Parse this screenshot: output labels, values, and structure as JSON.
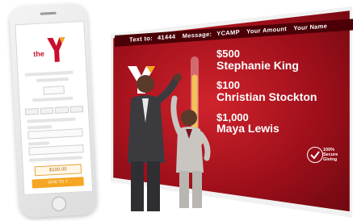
{
  "phone": {
    "logo_text": "the",
    "amount_value": "$100.00",
    "give_button_label": "GIVE TO Y"
  },
  "screen": {
    "topbar": {
      "text_to_label": "Text to:",
      "text_to_number": "41444",
      "message_label": "Message:",
      "message_value": "YCAMP",
      "amount_placeholder": "Your Amount",
      "name_placeholder": "Your Name"
    },
    "donors": [
      {
        "amount": "$500",
        "name": "Stephanie King"
      },
      {
        "amount": "$100",
        "name": "Christian Stockton"
      },
      {
        "amount": "$1,000",
        "name": "Maya Lewis"
      }
    ],
    "badge": {
      "line1": "100%",
      "line2": "Secure",
      "line3": "Giving"
    },
    "thermometer_fill_fraction": 0.78
  },
  "colors": {
    "ymca_red": "#c8102e",
    "ymca_orange": "#f5a623",
    "screen_red": "#b3141f",
    "topbar_dark": "#4a0006",
    "thermo_gold": "#f4c15a"
  }
}
